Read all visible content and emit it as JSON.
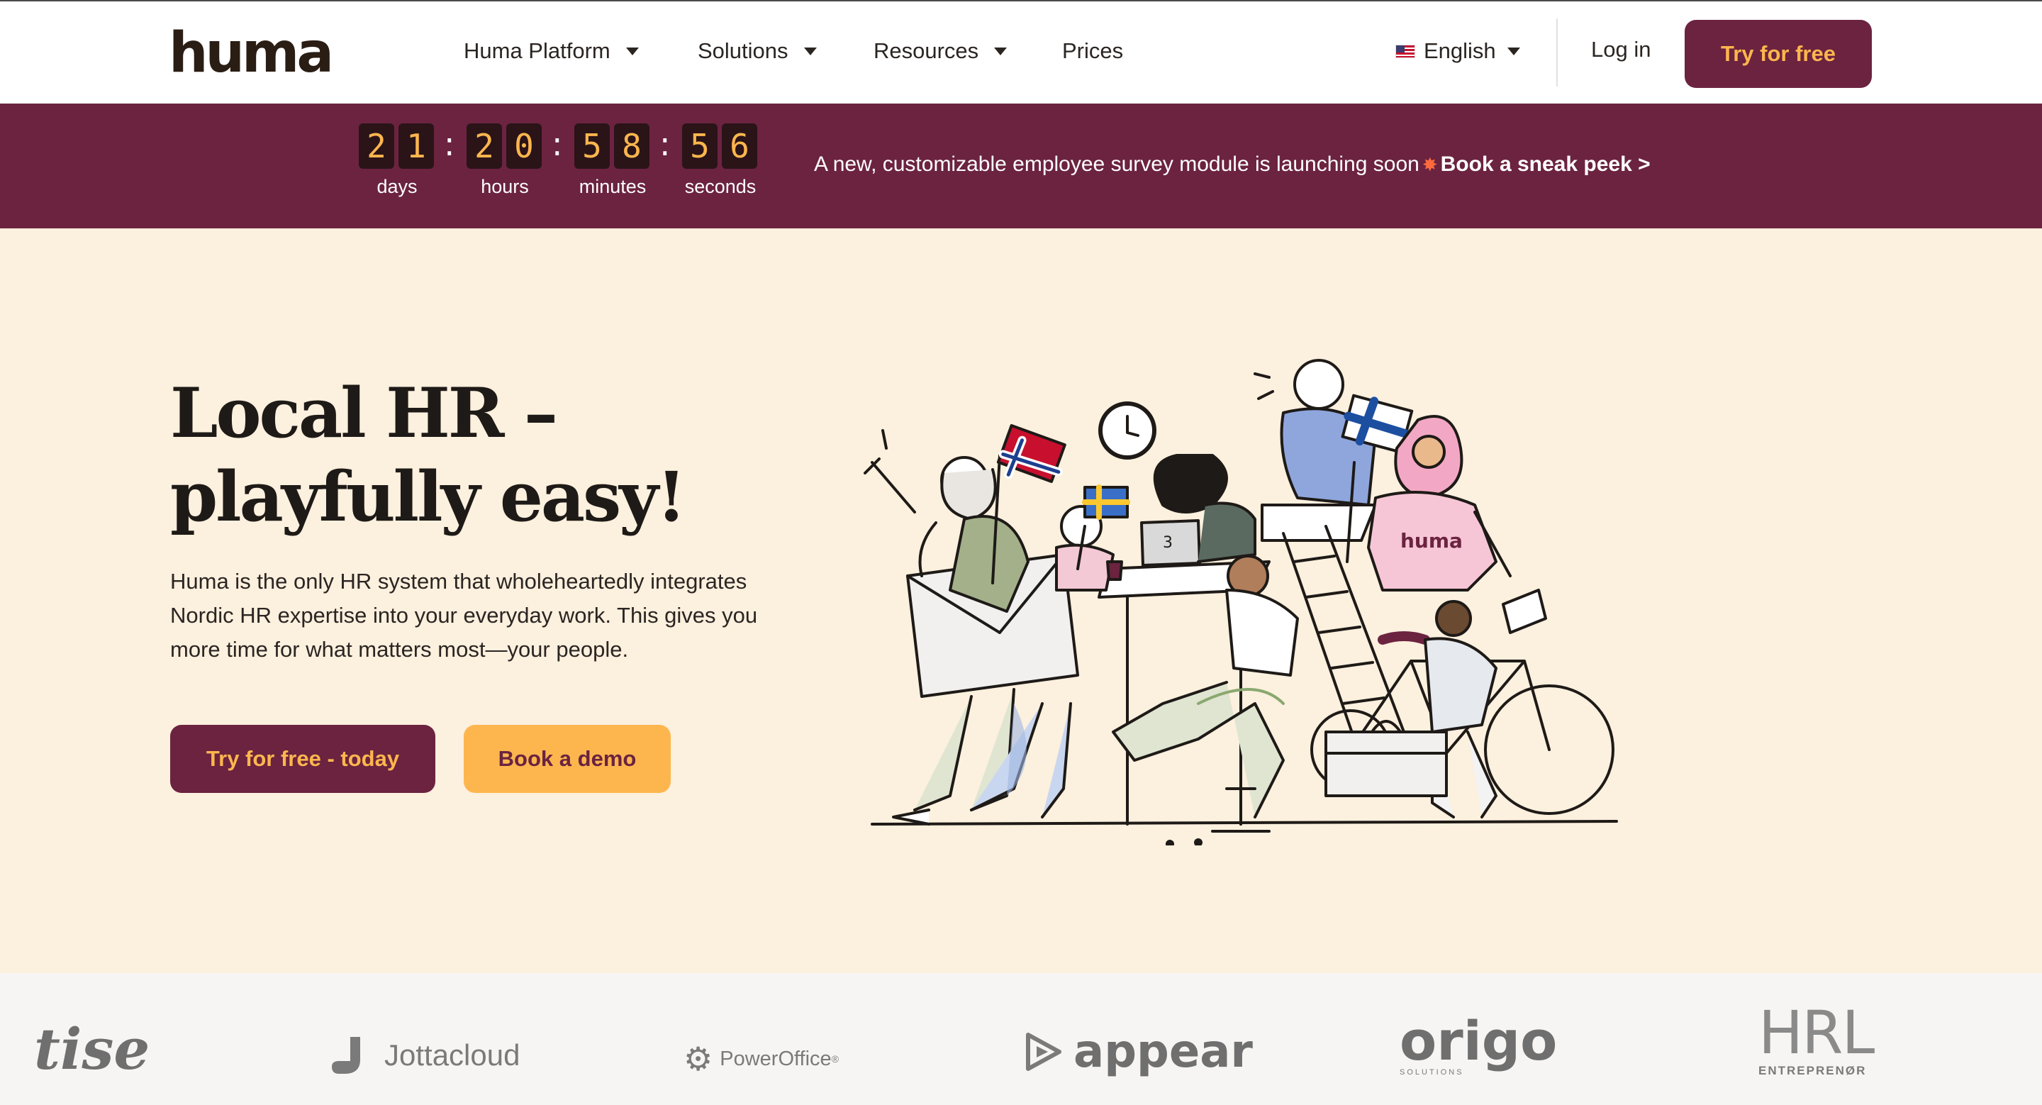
{
  "brand": {
    "logo_text": "huma"
  },
  "nav": {
    "items": [
      {
        "label": "Huma Platform",
        "dropdown": true
      },
      {
        "label": "Solutions",
        "dropdown": true
      },
      {
        "label": "Resources",
        "dropdown": true
      },
      {
        "label": "Prices",
        "dropdown": false
      }
    ],
    "language": "English",
    "login": "Log in",
    "cta": "Try for free"
  },
  "banner": {
    "countdown": {
      "days": "21",
      "hours": "20",
      "minutes": "58",
      "seconds": "56",
      "labels": {
        "days": "days",
        "hours": "hours",
        "minutes": "minutes",
        "seconds": "seconds"
      }
    },
    "text": "A new, customizable employee survey module is launching soon",
    "link": "Book a sneak peek >"
  },
  "hero": {
    "title_line1": "Local HR –",
    "title_line2": "playfully easy!",
    "body": "Huma is the only HR system that wholeheartedly integrates Nordic HR expertise into your everyday work. This gives you more time for what matters most—your people.",
    "primary_cta": "Try for free - today",
    "secondary_cta": "Book a demo",
    "illustration_shirt_text": "huma",
    "illustration_laptop_text": "3"
  },
  "customers": [
    {
      "name": "tise",
      "icon": "tise-logo"
    },
    {
      "name": "Jottacloud",
      "icon": "jottacloud-logo"
    },
    {
      "name": "PowerOffice",
      "icon": "poweroffice-logo"
    },
    {
      "name": "appear",
      "icon": "appear-logo"
    },
    {
      "name": "origo",
      "sub": "SOLUTIONS",
      "icon": "origo-logo"
    },
    {
      "name": "HRL",
      "sub": "ENTREPRENØR",
      "icon": "hrl-logo"
    }
  ],
  "colors": {
    "brand": "#6b2340",
    "accent": "#fdb64e",
    "hero_bg": "#fcf0de"
  }
}
